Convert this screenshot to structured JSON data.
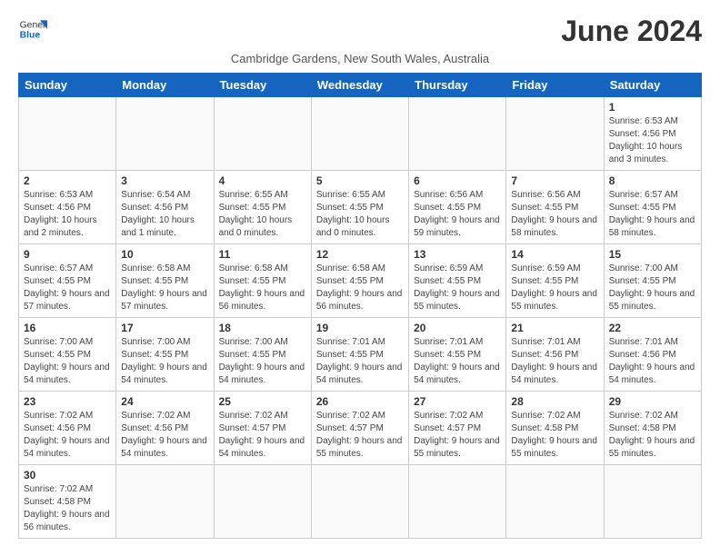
{
  "header": {
    "logo_general": "General",
    "logo_blue": "Blue",
    "month_title": "June 2024",
    "subtitle": "Cambridge Gardens, New South Wales, Australia"
  },
  "weekdays": [
    "Sunday",
    "Monday",
    "Tuesday",
    "Wednesday",
    "Thursday",
    "Friday",
    "Saturday"
  ],
  "weeks": [
    [
      {
        "day": "",
        "info": ""
      },
      {
        "day": "",
        "info": ""
      },
      {
        "day": "",
        "info": ""
      },
      {
        "day": "",
        "info": ""
      },
      {
        "day": "",
        "info": ""
      },
      {
        "day": "",
        "info": ""
      },
      {
        "day": "1",
        "info": "Sunrise: 6:53 AM\nSunset: 4:56 PM\nDaylight: 10 hours\nand 3 minutes."
      }
    ],
    [
      {
        "day": "2",
        "info": "Sunrise: 6:53 AM\nSunset: 4:56 PM\nDaylight: 10 hours\nand 2 minutes."
      },
      {
        "day": "3",
        "info": "Sunrise: 6:54 AM\nSunset: 4:56 PM\nDaylight: 10 hours\nand 1 minute."
      },
      {
        "day": "4",
        "info": "Sunrise: 6:55 AM\nSunset: 4:55 PM\nDaylight: 10 hours\nand 0 minutes."
      },
      {
        "day": "5",
        "info": "Sunrise: 6:55 AM\nSunset: 4:55 PM\nDaylight: 10 hours\nand 0 minutes."
      },
      {
        "day": "6",
        "info": "Sunrise: 6:56 AM\nSunset: 4:55 PM\nDaylight: 9 hours\nand 59 minutes."
      },
      {
        "day": "7",
        "info": "Sunrise: 6:56 AM\nSunset: 4:55 PM\nDaylight: 9 hours\nand 58 minutes."
      },
      {
        "day": "8",
        "info": "Sunrise: 6:57 AM\nSunset: 4:55 PM\nDaylight: 9 hours\nand 58 minutes."
      }
    ],
    [
      {
        "day": "9",
        "info": "Sunrise: 6:57 AM\nSunset: 4:55 PM\nDaylight: 9 hours\nand 57 minutes."
      },
      {
        "day": "10",
        "info": "Sunrise: 6:58 AM\nSunset: 4:55 PM\nDaylight: 9 hours\nand 57 minutes."
      },
      {
        "day": "11",
        "info": "Sunrise: 6:58 AM\nSunset: 4:55 PM\nDaylight: 9 hours\nand 56 minutes."
      },
      {
        "day": "12",
        "info": "Sunrise: 6:58 AM\nSunset: 4:55 PM\nDaylight: 9 hours\nand 56 minutes."
      },
      {
        "day": "13",
        "info": "Sunrise: 6:59 AM\nSunset: 4:55 PM\nDaylight: 9 hours\nand 55 minutes."
      },
      {
        "day": "14",
        "info": "Sunrise: 6:59 AM\nSunset: 4:55 PM\nDaylight: 9 hours\nand 55 minutes."
      },
      {
        "day": "15",
        "info": "Sunrise: 7:00 AM\nSunset: 4:55 PM\nDaylight: 9 hours\nand 55 minutes."
      }
    ],
    [
      {
        "day": "16",
        "info": "Sunrise: 7:00 AM\nSunset: 4:55 PM\nDaylight: 9 hours\nand 54 minutes."
      },
      {
        "day": "17",
        "info": "Sunrise: 7:00 AM\nSunset: 4:55 PM\nDaylight: 9 hours\nand 54 minutes."
      },
      {
        "day": "18",
        "info": "Sunrise: 7:00 AM\nSunset: 4:55 PM\nDaylight: 9 hours\nand 54 minutes."
      },
      {
        "day": "19",
        "info": "Sunrise: 7:01 AM\nSunset: 4:55 PM\nDaylight: 9 hours\nand 54 minutes."
      },
      {
        "day": "20",
        "info": "Sunrise: 7:01 AM\nSunset: 4:55 PM\nDaylight: 9 hours\nand 54 minutes."
      },
      {
        "day": "21",
        "info": "Sunrise: 7:01 AM\nSunset: 4:56 PM\nDaylight: 9 hours\nand 54 minutes."
      },
      {
        "day": "22",
        "info": "Sunrise: 7:01 AM\nSunset: 4:56 PM\nDaylight: 9 hours\nand 54 minutes."
      }
    ],
    [
      {
        "day": "23",
        "info": "Sunrise: 7:02 AM\nSunset: 4:56 PM\nDaylight: 9 hours\nand 54 minutes."
      },
      {
        "day": "24",
        "info": "Sunrise: 7:02 AM\nSunset: 4:56 PM\nDaylight: 9 hours\nand 54 minutes."
      },
      {
        "day": "25",
        "info": "Sunrise: 7:02 AM\nSunset: 4:57 PM\nDaylight: 9 hours\nand 54 minutes."
      },
      {
        "day": "26",
        "info": "Sunrise: 7:02 AM\nSunset: 4:57 PM\nDaylight: 9 hours\nand 55 minutes."
      },
      {
        "day": "27",
        "info": "Sunrise: 7:02 AM\nSunset: 4:57 PM\nDaylight: 9 hours\nand 55 minutes."
      },
      {
        "day": "28",
        "info": "Sunrise: 7:02 AM\nSunset: 4:58 PM\nDaylight: 9 hours\nand 55 minutes."
      },
      {
        "day": "29",
        "info": "Sunrise: 7:02 AM\nSunset: 4:58 PM\nDaylight: 9 hours\nand 55 minutes."
      }
    ],
    [
      {
        "day": "30",
        "info": "Sunrise: 7:02 AM\nSunset: 4:58 PM\nDaylight: 9 hours\nand 56 minutes."
      },
      {
        "day": "",
        "info": ""
      },
      {
        "day": "",
        "info": ""
      },
      {
        "day": "",
        "info": ""
      },
      {
        "day": "",
        "info": ""
      },
      {
        "day": "",
        "info": ""
      },
      {
        "day": "",
        "info": ""
      }
    ]
  ]
}
